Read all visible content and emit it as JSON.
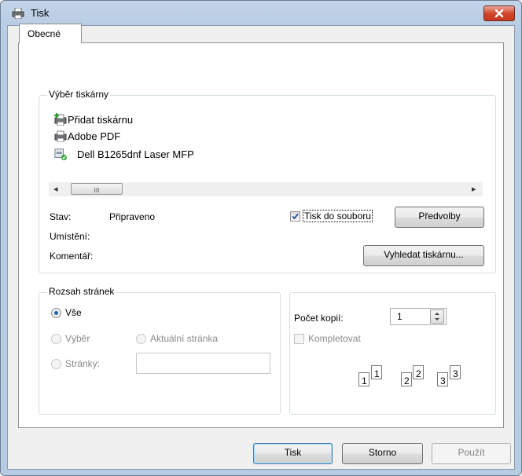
{
  "window": {
    "title": "Tisk",
    "close_icon": "close-x-icon"
  },
  "tabs": [
    {
      "label": "Obecné"
    }
  ],
  "printer_group": {
    "label": "Výběr tiskárny",
    "printers": [
      {
        "name": "Přidat tiskárnu",
        "icon": "add-printer-icon"
      },
      {
        "name": "Adobe PDF",
        "icon": "printer-icon"
      },
      {
        "name": "Dell B1265dnf Laser MFP",
        "icon": "default-printer-icon"
      }
    ],
    "scrollbar": {
      "left_arrow": "◂",
      "right_arrow": "▸",
      "grip": "III"
    },
    "status_label": "Stav:",
    "status_value": "Připraveno",
    "location_label": "Umístění:",
    "comment_label": "Komentář:",
    "print_to_file_label": "Tisk do souboru",
    "print_to_file_checked": true,
    "preferences_button": "Předvolby",
    "find_printer_button": "Vyhledat tiskárnu..."
  },
  "page_range": {
    "label": "Rozsah stránek",
    "all_label": "Vše",
    "selection_label": "Výběr",
    "current_page_label": "Aktuální stránka",
    "pages_label": "Stránky:",
    "pages_value": ""
  },
  "copies": {
    "count_label": "Počet kopií:",
    "count_value": "1",
    "collate_label": "Kompletovat",
    "collate_checked": false,
    "collate_icon_digits": [
      "1",
      "1",
      "2",
      "2",
      "3",
      "3"
    ]
  },
  "buttons": {
    "print": "Tisk",
    "cancel": "Storno",
    "apply": "Použít"
  }
}
